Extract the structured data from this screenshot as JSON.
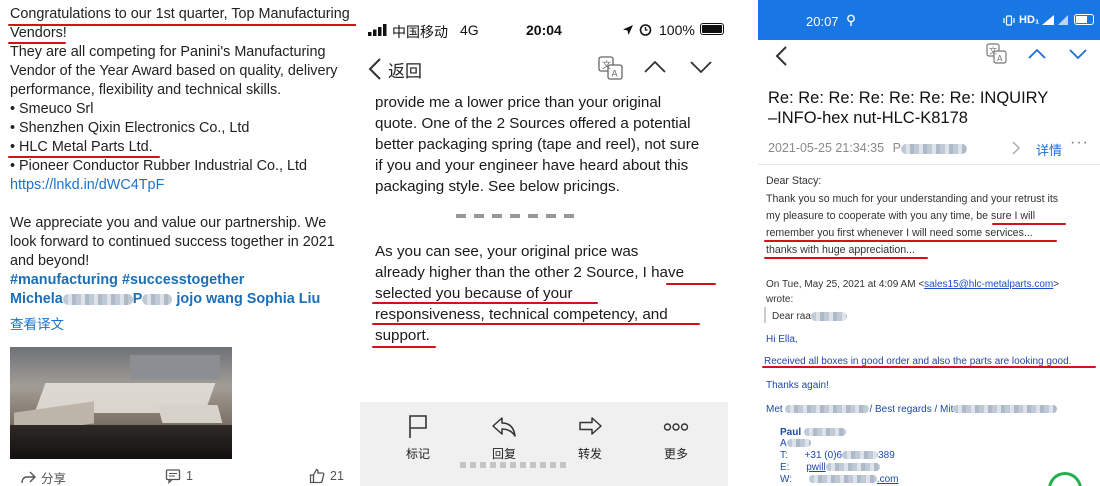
{
  "linkedin_post": {
    "lines": [
      "Congratulations to our 1st quarter, Top Manufacturing",
      "Vendors!",
      "They are all competing for Panini's Manufacturing",
      "Vendor of the Year Award based on quality, delivery",
      "performance, flexibility and technical skills.",
      "• Smeuco Srl",
      "• Shenzhen Qixin Electronics Co., Ltd",
      "• HLC Metal Parts Ltd.",
      "• Pioneer Conductor Rubber Industrial Co., Ltd"
    ],
    "short_link": "https://lnkd.in/dWC4TpF",
    "closing": [
      "We appreciate you and value our partnership. We",
      "look forward to continued success together in 2021",
      "and beyond!"
    ],
    "hashtags": "#manufacturing #successtogether",
    "mention_start": "Michela",
    "mention_mid": "P",
    "mention_end": "jojo wang Sophia Liu",
    "translate": "查看译文",
    "share_label": "分享",
    "comment_count": "1",
    "like_count": "21"
  },
  "ios_mail": {
    "status": {
      "carrier": "中国移动",
      "network": "4G",
      "time": "20:04",
      "battery": "100%"
    },
    "back_label": "返回",
    "body_top": [
      "provide me a lower price than your original",
      "quote.  One of the 2 Sources offered a potential",
      "better packaging spring (tape and reel), not sure",
      "if you and your engineer have heard about this",
      "packaging style.  See below pricings."
    ],
    "body_bottom": [
      "As you can see, your original price was",
      "already higher than the other 2 Source, I have",
      "selected you because of your",
      "responsiveness, technical competency, and",
      "support."
    ],
    "toolbar": [
      {
        "label": "标记",
        "icon": "flag-icon"
      },
      {
        "label": "回复",
        "icon": "reply-icon"
      },
      {
        "label": "转发",
        "icon": "forward-icon"
      },
      {
        "label": "更多",
        "icon": "more-icon"
      }
    ]
  },
  "android_mail": {
    "status": {
      "time": "20:07"
    },
    "subject_line1": "Re: Re: Re: Re: Re: Re: Re: INQUIRY",
    "subject_line2": "–INFO-hex nut-HLC-K8178",
    "date": "2021-05-25 21:34:35",
    "sender_start": "P",
    "details_label": "详情",
    "greeting": "Dear Stacy:",
    "para": [
      "   Thank you so much for your understanding and your retrust its",
      "my pleasure to cooperate with you any time, be sure I will",
      "remember you first whenever I will need some services...",
      "thanks with huge appreciation..."
    ],
    "quote_header_a": "On Tue, May 25, 2021 at 4:09 AM <",
    "quote_email": "sales15@hlc-metalparts.com",
    "quote_header_b": ">",
    "wrote": "wrote:",
    "quoted_greeting": "Dear raa",
    "hi": "Hi Ella,",
    "received": "Received all boxes in good order and also the parts are looking good.",
    "thanks": "Thanks again!",
    "met_start": "Met",
    "met_mid": "/ Best regards / Mit",
    "sig_name": "Paul",
    "sig_a": "A",
    "sig_t_label": "T:",
    "sig_t_start": "+31 (0)6",
    "sig_t_end": "389",
    "sig_e_label": "E:",
    "sig_e_start": "pwill",
    "sig_w_label": "W:",
    "sig_w_end": ".com"
  }
}
